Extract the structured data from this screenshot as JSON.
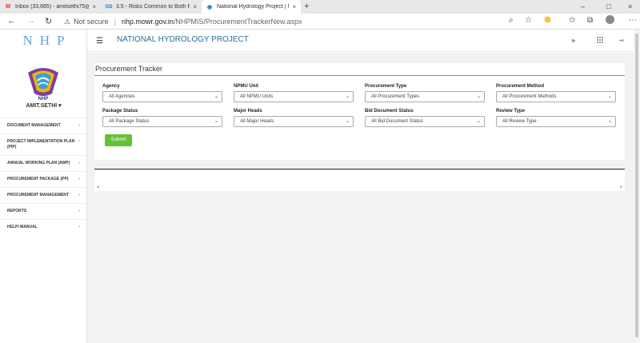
{
  "browser": {
    "tabs": [
      {
        "title": "Inbox (33,685) - amitsethi75@gm",
        "icon": "gmail-icon"
      },
      {
        "title": "3.5 - Risks Common to Both Pha",
        "icon": "gd-icon"
      },
      {
        "title": "National Hydrology Project | MIS",
        "icon": "site-icon"
      }
    ],
    "favicon_text": "GD",
    "close_glyph": "×",
    "new_tab_glyph": "+",
    "window_controls": [
      "–",
      "□",
      "×"
    ],
    "security_label": "Not secure",
    "url_domain": "nhp.mowr.gov.in",
    "url_path": "/NHPMIS/ProcurementTrackerNew.aspx"
  },
  "sidebar": {
    "brand": "NHP",
    "logo_text": "NHP",
    "username": "AMIT.SETHI",
    "items": [
      {
        "label": "DOCUMENT MANAGEMENT"
      },
      {
        "label": "PROJECT IMPLEMENTATION PLAN (PIP)"
      },
      {
        "label": "ANNUAL WORKING PLAN (AWP)"
      },
      {
        "label": "PROCUREMENT PACKAGE (PP)"
      },
      {
        "label": "PROCUREMENT MANAGEMENT"
      },
      {
        "label": "REPORTS"
      },
      {
        "label": "HELP/ MANUAL"
      }
    ]
  },
  "header": {
    "title": "NATIONAL HYDROLOGY PROJECT",
    "icons": [
      "speaker-icon",
      "apps-grid-icon",
      "expand-icon"
    ]
  },
  "tracker": {
    "title": "Procurement Tracker",
    "fields": [
      {
        "label": "Agency",
        "value": "All Agencies"
      },
      {
        "label": "NPMU Unit",
        "value": "All NPMU Units"
      },
      {
        "label": "Procurement Type",
        "value": "All Procurement Types"
      },
      {
        "label": "Procurement Method",
        "value": "All Procurement Methods"
      },
      {
        "label": "Package Status",
        "value": "All Package Status"
      },
      {
        "label": "Major Heads",
        "value": "All Major Heads"
      },
      {
        "label": "Bid Document Status",
        "value": "All Bid Document Status"
      },
      {
        "label": "Review Type",
        "value": "All Review Type"
      }
    ],
    "submit_label": "Submit"
  },
  "colors": {
    "accent_green": "#64c133",
    "title_blue": "#2d6e98",
    "brand_blue": "#6aa1d6"
  }
}
